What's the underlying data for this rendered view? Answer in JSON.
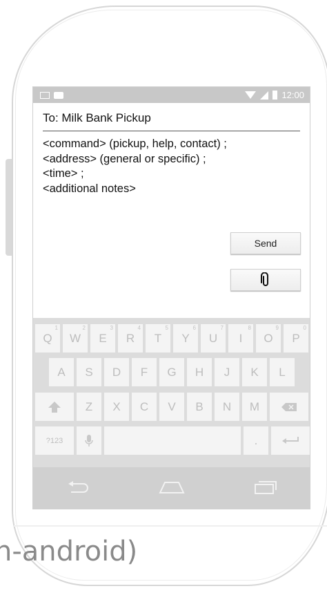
{
  "message": {
    "to": "To: Milk Bank Pickup",
    "body_lines": [
      "<command> (pickup, help, contact) ;",
      "<address> (general or specific) ;",
      "<time> ;",
      "<additional notes>"
    ]
  },
  "actions": {
    "send_label": "Send",
    "attach_icon": "paperclip-icon"
  },
  "status_bar": {
    "time": "12:00",
    "icons": [
      "mail-icon",
      "chat-icon",
      "wifi-icon",
      "signal-icon",
      "battery-icon"
    ]
  },
  "keyboard": {
    "row1": [
      {
        "label": "Q",
        "sub": "1"
      },
      {
        "label": "W",
        "sub": "2"
      },
      {
        "label": "E",
        "sub": "3"
      },
      {
        "label": "R",
        "sub": "4"
      },
      {
        "label": "T",
        "sub": "5"
      },
      {
        "label": "Y",
        "sub": "6"
      },
      {
        "label": "U",
        "sub": "7"
      },
      {
        "label": "I",
        "sub": "8"
      },
      {
        "label": "O",
        "sub": "9"
      },
      {
        "label": "P",
        "sub": "0"
      }
    ],
    "row2": [
      "A",
      "S",
      "D",
      "F",
      "G",
      "H",
      "J",
      "K",
      "L"
    ],
    "row3": [
      "Z",
      "X",
      "C",
      "V",
      "B",
      "N",
      "M"
    ],
    "symbols_label": "?123",
    "period_label": "."
  },
  "nav": {
    "icons": [
      "back-icon",
      "home-icon",
      "recent-apps-icon"
    ]
  },
  "watermark": "n-android)"
}
